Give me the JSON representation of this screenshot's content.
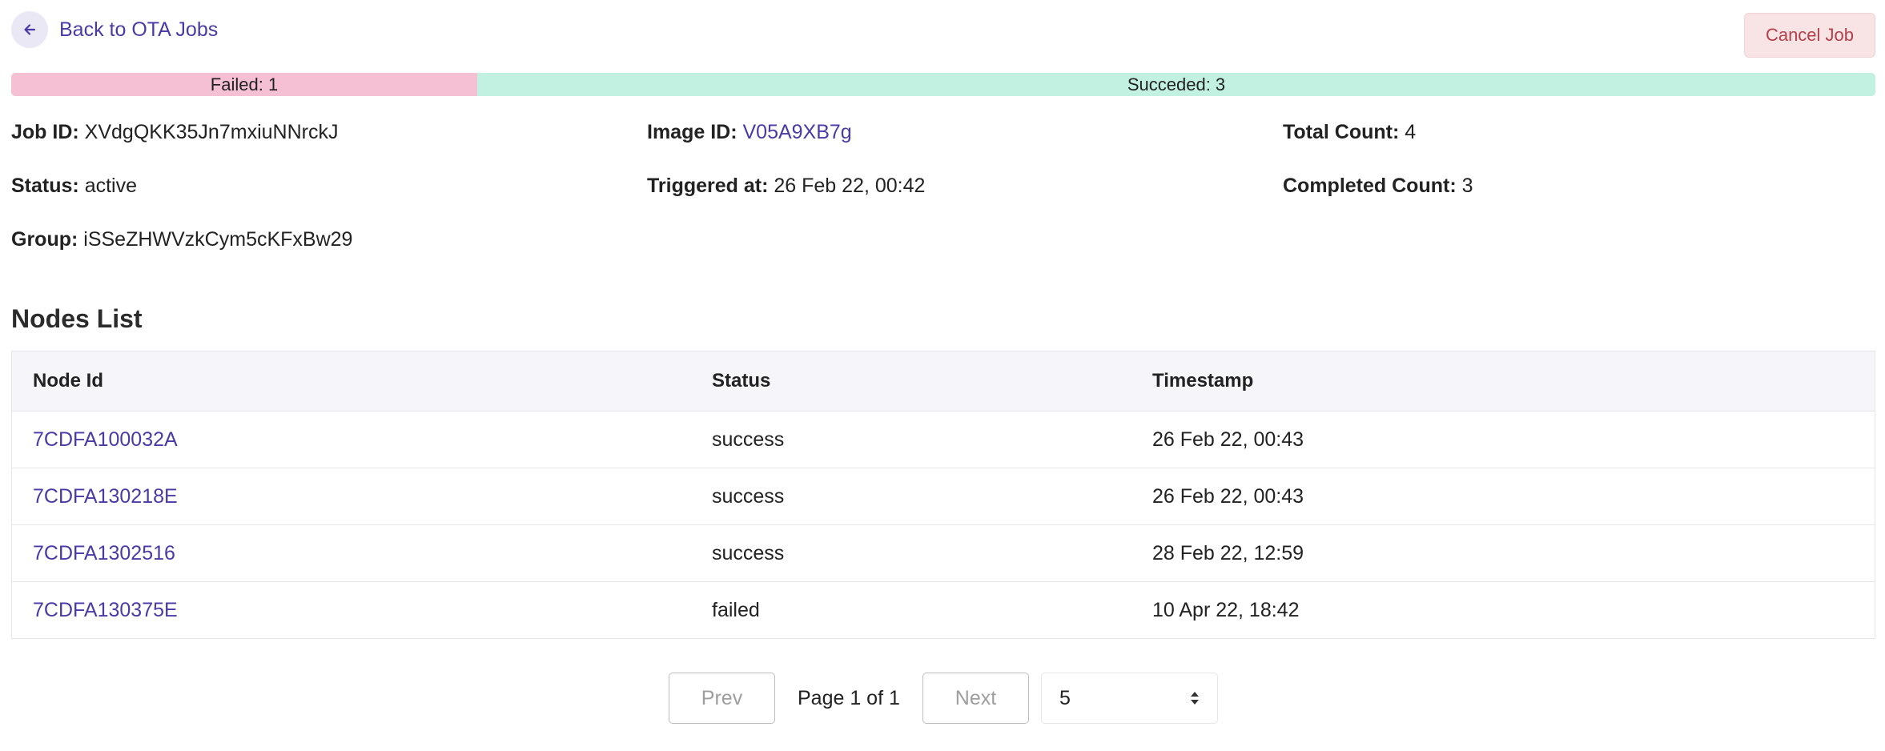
{
  "header": {
    "back_label": "Back to OTA Jobs",
    "cancel_label": "Cancel Job"
  },
  "progress": {
    "failed_label": "Failed: 1",
    "succeeded_label": "Succeded: 3",
    "failed_count": 1,
    "succeeded_count": 3,
    "failed_color": "#f6c0d4",
    "succeeded_color": "#c2f1e1"
  },
  "job": {
    "job_id_label": "Job ID:",
    "job_id": "XVdgQKK35Jn7mxiuNNrckJ",
    "image_id_label": "Image ID:",
    "image_id": "V05A9XB7g",
    "total_count_label": "Total Count:",
    "total_count": "4",
    "status_label": "Status:",
    "status": "active",
    "triggered_label": "Triggered at:",
    "triggered_at": "26 Feb 22, 00:42",
    "completed_label": "Completed Count:",
    "completed_count": "3",
    "group_label": "Group:",
    "group": "iSSeZHWVzkCym5cKFxBw29"
  },
  "nodes": {
    "title": "Nodes List",
    "columns": [
      "Node Id",
      "Status",
      "Timestamp"
    ],
    "rows": [
      {
        "node_id": "7CDFA100032A",
        "status": "success",
        "timestamp": "26 Feb 22, 00:43"
      },
      {
        "node_id": "7CDFA130218E",
        "status": "success",
        "timestamp": "26 Feb 22, 00:43"
      },
      {
        "node_id": "7CDFA1302516",
        "status": "success",
        "timestamp": "28 Feb 22, 12:59"
      },
      {
        "node_id": "7CDFA130375E",
        "status": "failed",
        "timestamp": "10 Apr 22, 18:42"
      }
    ]
  },
  "pagination": {
    "prev_label": "Prev",
    "page_info": "Page 1 of 1",
    "next_label": "Next",
    "page_size": "5"
  },
  "colors": {
    "accent": "#4a3aa7",
    "danger_text": "#b3404a",
    "danger_bg": "#f8e4e5"
  },
  "icons": {
    "back": "arrow-left-icon",
    "select": "sort-arrows-icon"
  }
}
